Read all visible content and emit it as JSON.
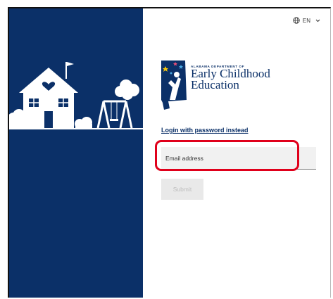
{
  "header": {
    "language_label": "EN",
    "language_icon": "globe-icon",
    "chevron_icon": "chevron-down-icon"
  },
  "brand": {
    "org_small": "ALABAMA DEPARTMENT OF",
    "org_line1": "Early Childhood",
    "org_line2": "Education",
    "colors": {
      "primary": "#0b3068",
      "accent_blue": "#4aa7e0",
      "accent_yellow": "#f1c40f",
      "accent_pink": "#e94e77"
    }
  },
  "login": {
    "alt_link_label": "Login with password instead",
    "email_placeholder": "Email address",
    "submit_label": "Submit"
  },
  "annotation": {
    "highlight_color": "#e0001b"
  }
}
